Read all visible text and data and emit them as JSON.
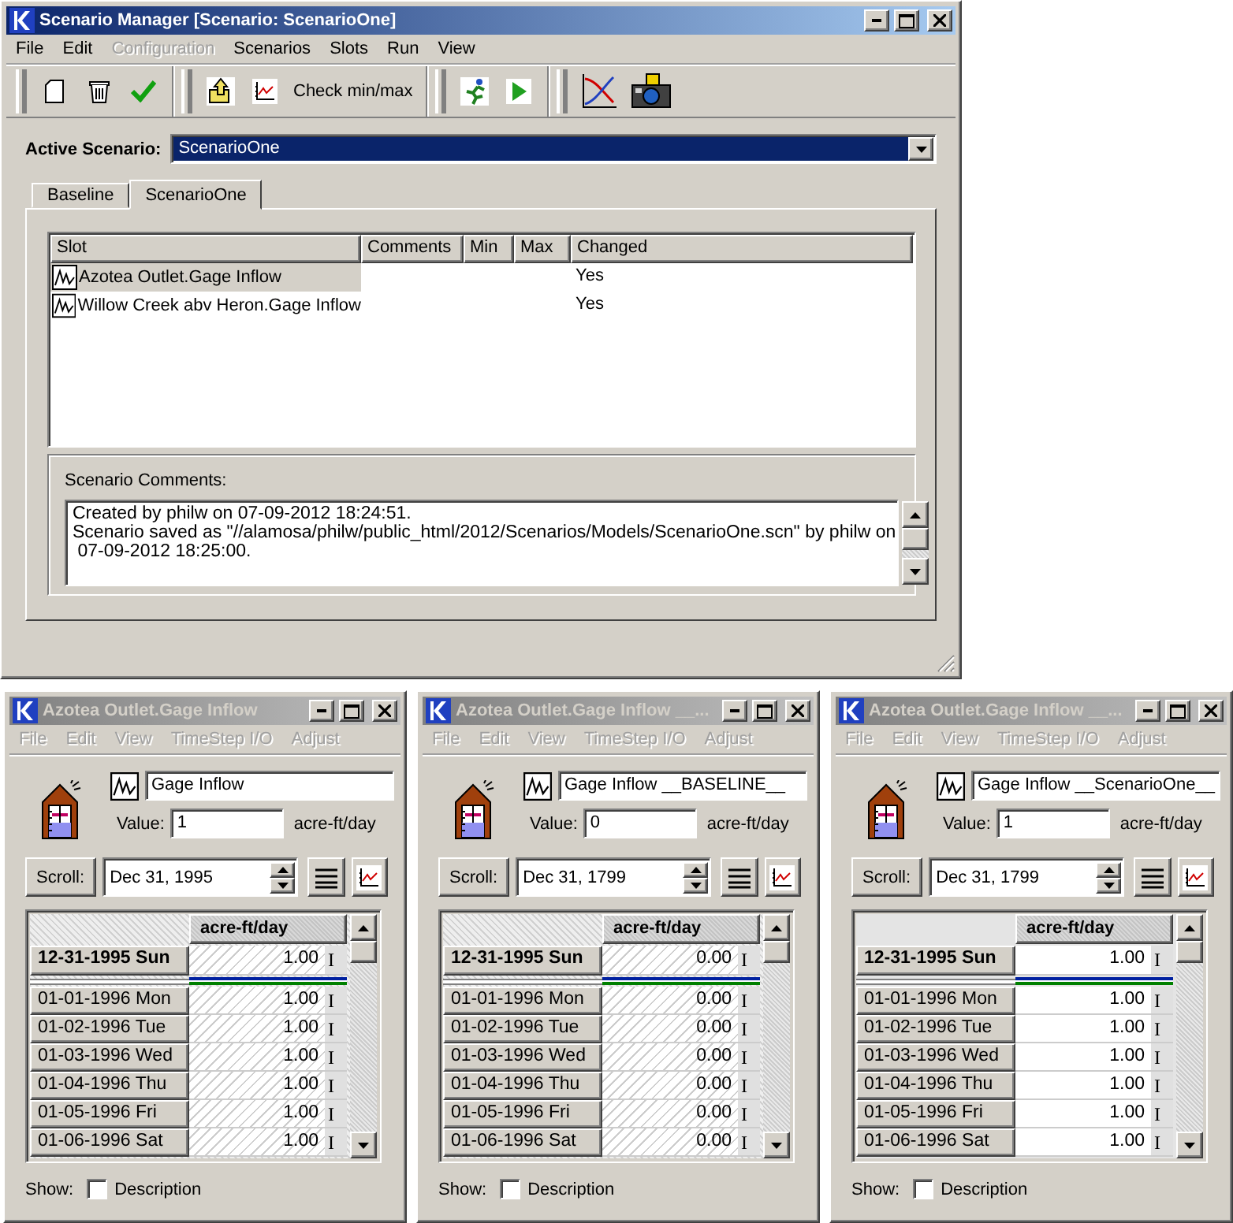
{
  "main": {
    "title": "Scenario Manager [Scenario: ScenarioOne]",
    "active": true,
    "menu": [
      {
        "label": "File",
        "disabled": false
      },
      {
        "label": "Edit",
        "disabled": false
      },
      {
        "label": "Configuration",
        "disabled": true
      },
      {
        "label": "Scenarios",
        "disabled": false
      },
      {
        "label": "Slots",
        "disabled": false
      },
      {
        "label": "Run",
        "disabled": false
      },
      {
        "label": "View",
        "disabled": false
      }
    ],
    "toolbar": {
      "check_label": "Check min/max"
    },
    "active_scenario": {
      "label": "Active Scenario:",
      "value": "ScenarioOne"
    },
    "tabs": [
      {
        "label": "Baseline",
        "selected": false
      },
      {
        "label": "ScenarioOne",
        "selected": true
      }
    ],
    "table": {
      "columns": [
        "Slot",
        "Comments",
        "Min",
        "Max",
        "Changed"
      ],
      "rows": [
        {
          "slot": "Azotea Outlet.Gage Inflow",
          "changed": "Yes",
          "selected": true
        },
        {
          "slot": "Willow Creek abv Heron.Gage Inflow",
          "changed": "Yes",
          "selected": false
        }
      ]
    },
    "comments": {
      "label": "Scenario Comments:",
      "lines": [
        "Created by philw on 07-09-2012 18:24:51.",
        "Scenario saved as \"//alamosa/philw/public_html/2012/Scenarios/Models/ScenarioOne.scn\" by philw on",
        " 07-09-2012 18:25:00."
      ]
    }
  },
  "windows": [
    {
      "title": "Azotea Outlet.Gage Inflow",
      "active": false,
      "menu": [
        "File",
        "Edit",
        "View",
        "TimeStep I/O",
        "Adjust"
      ],
      "slot_name": "Gage Inflow",
      "value_label": "Value:",
      "value": "1",
      "units": "acre-ft/day",
      "scroll_label": "Scroll:",
      "date": "Dec 31, 1995",
      "column": "acre-ft/day",
      "hatched": true,
      "current": {
        "date": "12-31-1995 Sun",
        "value": "1.00",
        "flag": "I"
      },
      "rows": [
        {
          "date": "01-01-1996 Mon",
          "value": "1.00",
          "flag": "I"
        },
        {
          "date": "01-02-1996 Tue",
          "value": "1.00",
          "flag": "I"
        },
        {
          "date": "01-03-1996 Wed",
          "value": "1.00",
          "flag": "I"
        },
        {
          "date": "01-04-1996 Thu",
          "value": "1.00",
          "flag": "I"
        },
        {
          "date": "01-05-1996 Fri",
          "value": "1.00",
          "flag": "I"
        },
        {
          "date": "01-06-1996 Sat",
          "value": "1.00",
          "flag": "I"
        }
      ],
      "show_label": "Show:",
      "description": {
        "label": "Description",
        "checked": false
      }
    },
    {
      "title": "Azotea Outlet.Gage Inflow __...",
      "active": false,
      "menu": [
        "File",
        "Edit",
        "View",
        "TimeStep I/O",
        "Adjust"
      ],
      "slot_name": "Gage Inflow __BASELINE__",
      "value_label": "Value:",
      "value": "0",
      "units": "acre-ft/day",
      "scroll_label": "Scroll:",
      "date": "Dec 31, 1799",
      "column": "acre-ft/day",
      "hatched": true,
      "current": {
        "date": "12-31-1995 Sun",
        "value": "0.00",
        "flag": "I"
      },
      "rows": [
        {
          "date": "01-01-1996 Mon",
          "value": "0.00",
          "flag": "I"
        },
        {
          "date": "01-02-1996 Tue",
          "value": "0.00",
          "flag": "I"
        },
        {
          "date": "01-03-1996 Wed",
          "value": "0.00",
          "flag": "I"
        },
        {
          "date": "01-04-1996 Thu",
          "value": "0.00",
          "flag": "I"
        },
        {
          "date": "01-05-1996 Fri",
          "value": "0.00",
          "flag": "I"
        },
        {
          "date": "01-06-1996 Sat",
          "value": "0.00",
          "flag": "I"
        }
      ],
      "show_label": "Show:",
      "description": {
        "label": "Description",
        "checked": false
      }
    },
    {
      "title": "Azotea Outlet.Gage Inflow __...",
      "active": false,
      "menu": [
        "File",
        "Edit",
        "View",
        "TimeStep I/O",
        "Adjust"
      ],
      "slot_name": "Gage Inflow __ScenarioOne__",
      "value_label": "Value:",
      "value": "1",
      "units": "acre-ft/day",
      "scroll_label": "Scroll:",
      "date": "Dec 31, 1799",
      "column": "acre-ft/day",
      "hatched": false,
      "current": {
        "date": "12-31-1995 Sun",
        "value": "1.00",
        "flag": "I"
      },
      "rows": [
        {
          "date": "01-01-1996 Mon",
          "value": "1.00",
          "flag": "I"
        },
        {
          "date": "01-02-1996 Tue",
          "value": "1.00",
          "flag": "I"
        },
        {
          "date": "01-03-1996 Wed",
          "value": "1.00",
          "flag": "I"
        },
        {
          "date": "01-04-1996 Thu",
          "value": "1.00",
          "flag": "I"
        },
        {
          "date": "01-05-1996 Fri",
          "value": "1.00",
          "flag": "I"
        },
        {
          "date": "01-06-1996 Sat",
          "value": "1.00",
          "flag": "I"
        }
      ],
      "show_label": "Show:",
      "description": {
        "label": "Description",
        "checked": false
      }
    }
  ]
}
